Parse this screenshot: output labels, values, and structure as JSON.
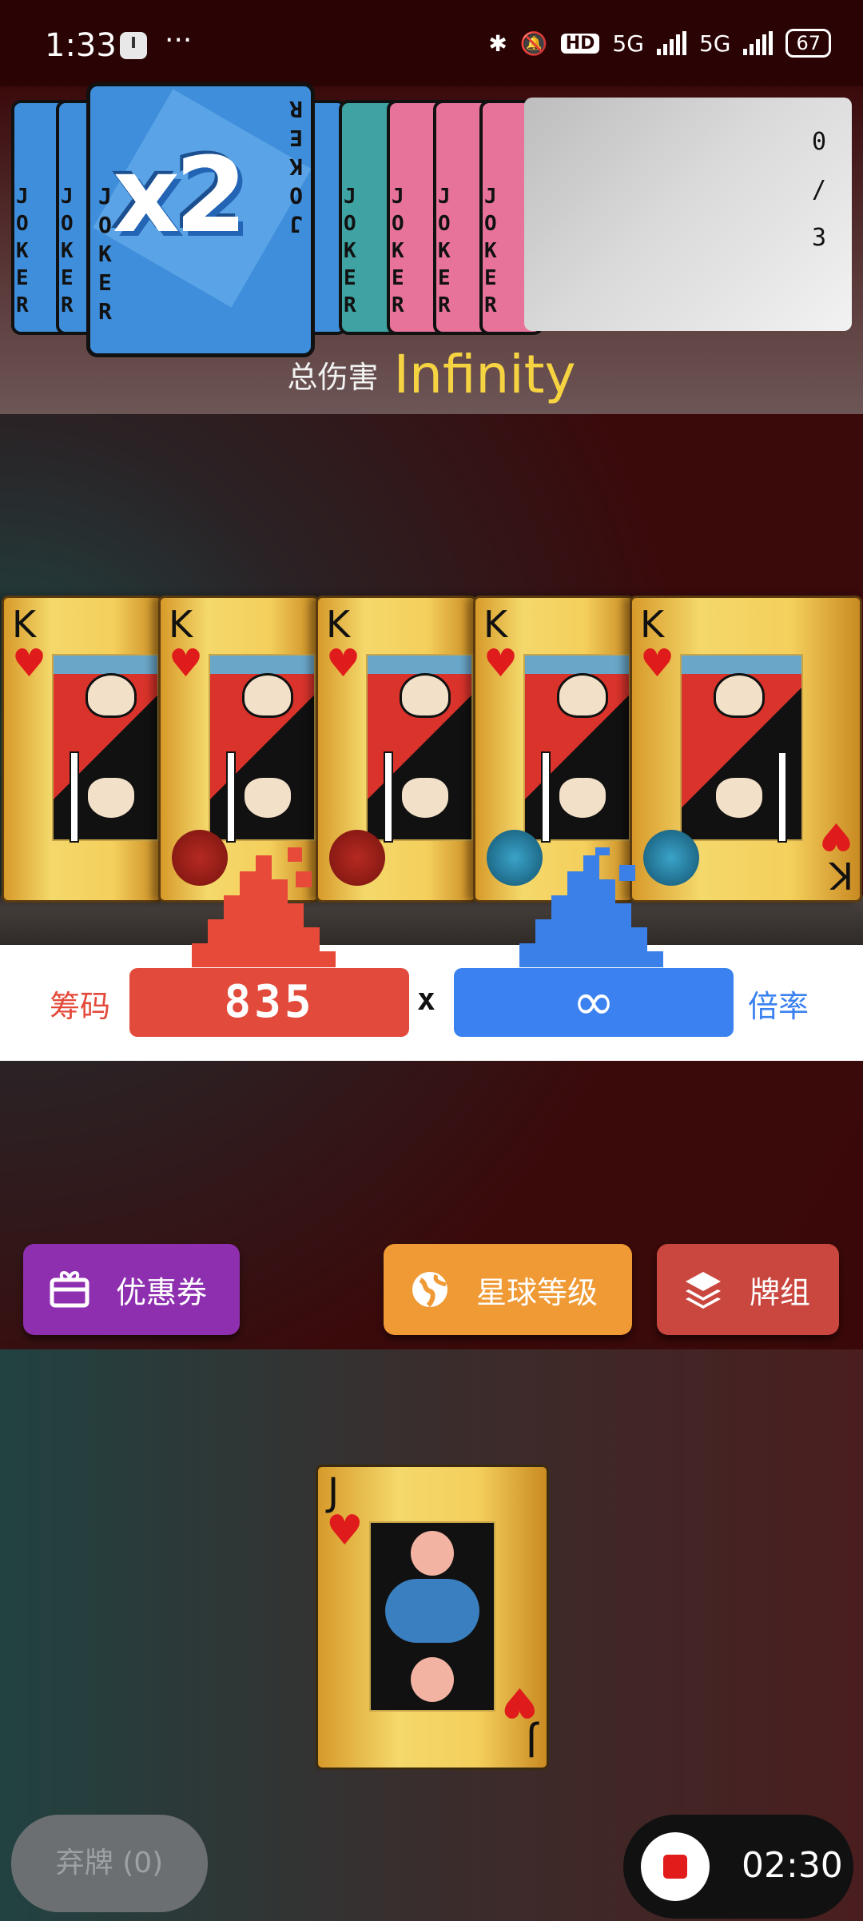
{
  "status_bar": {
    "time": "1:33",
    "more": "···",
    "network": "5G",
    "hd": "HD",
    "battery": "67"
  },
  "jokers": {
    "card_text": "JOKER",
    "featured_mult": "x2",
    "slot_counter": [
      "0",
      "/",
      "3"
    ]
  },
  "damage": {
    "label": "总伤害",
    "value": "Infinity"
  },
  "played_hand": {
    "cards": [
      {
        "rank": "K",
        "suit": "♥",
        "seal": "none"
      },
      {
        "rank": "K",
        "suit": "♥",
        "seal": "red"
      },
      {
        "rank": "K",
        "suit": "♥",
        "seal": "red"
      },
      {
        "rank": "K",
        "suit": "♥",
        "seal": "blue"
      },
      {
        "rank": "K",
        "suit": "♥",
        "seal": "blue"
      }
    ]
  },
  "score": {
    "chips_label": "筹码",
    "chips_value": "835",
    "times": "x",
    "mult_value": "∞",
    "mult_label": "倍率",
    "chips_color": "#e24b3b",
    "mult_color": "#3b82f0"
  },
  "buttons": {
    "coupon": "优惠券",
    "planet": "星球等级",
    "deck": "牌组",
    "coupon_icon": "gift-card-icon",
    "planet_icon": "globe-icon",
    "deck_icon": "layers-icon"
  },
  "hand": {
    "cards": [
      {
        "rank": "J",
        "suit": "♥"
      }
    ]
  },
  "discard": {
    "label": "弃牌 (0)"
  },
  "recorder": {
    "time": "02:30",
    "icon": "stop-record-icon"
  }
}
